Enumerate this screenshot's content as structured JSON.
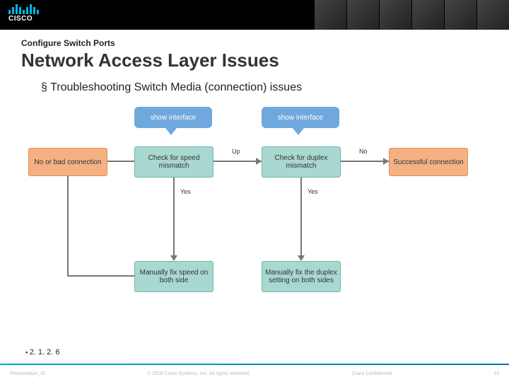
{
  "header": {
    "brand": "CISCO"
  },
  "slide": {
    "section": "Configure Switch Ports",
    "title": "Network Access Layer Issues",
    "bullet": "Troubleshooting Switch Media (connection) issues",
    "reference": "2. 1. 2. 6"
  },
  "flow": {
    "callout_left": "show interface",
    "callout_right": "show interface",
    "box_bad": "No or bad connection",
    "box_speed": "Check for speed mismatch",
    "box_duplex": "Check for duplex mismatch",
    "box_ok": "Successful connection",
    "box_fix_speed": "Manually fix speed on both side",
    "box_fix_duplex": "Manually fix the duplex setting on both sides",
    "lbl_up": "Up",
    "lbl_no": "No",
    "lbl_yes1": "Yes",
    "lbl_yes2": "Yes"
  },
  "footer": {
    "left": "Presentation_ID",
    "center": "© 2008 Cisco Systems, Inc. All rights reserved.",
    "right": "Cisco Confidential",
    "page": "19"
  }
}
